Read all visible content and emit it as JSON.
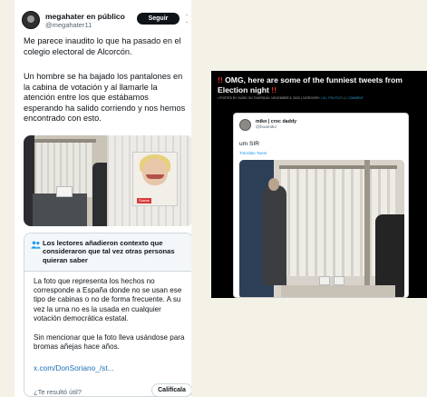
{
  "tweet": {
    "display_name": "megahater en público",
    "handle": "@megahater11",
    "follow_label": "Seguir",
    "more_icon": "more-options-icon",
    "paragraph_1": "Me parece inaudito lo que ha pasado en el colegio electoral de Alcorcón.",
    "paragraph_2": "Un hombre se ha bajado los pantalones en la cabina de votación y al llamarle la atención entre los que estábamos esperando ha salido corriendo y nos hemos encontrado con esto.",
    "media": {
      "left_photo": "voting-booth-photo",
      "right_photo": "campaign-poster-photo",
      "poster_badge": "Sumar"
    },
    "community_note": {
      "icon": "people-icon",
      "title": "Los lectores añadieron contexto que consideraron que tal vez otras personas quieran saber",
      "paragraph_1": "La foto que representa los hechos no corresponde a España donde no se usan ese tipo de cabinas o no de forma frecuente. A su vez la urna no es la usada en cualquier votación democrática estatal.",
      "paragraph_2": "Sin mencionar que la foto lleva usándose para bromas añejas hace años.",
      "link": "x.com/DonSoriano_/st...",
      "useful_question": "¿Te resultó útil?",
      "rate_label": "Califícala"
    }
  },
  "article": {
    "bang_left": "!!",
    "title": " OMG, here are some of the funniest tweets from Election night ",
    "bang_right": "!!",
    "meta_prefix": "• POSTED BY SUSIE ON THURSDAY, NOVEMBER 5, 2020 | CATEGORY: ",
    "meta_category": "LOL, POLITICS",
    "meta_separator": " | ",
    "meta_comment": "1 COMMENT",
    "embed": {
      "name": "miko | croc daddy",
      "handle": "@hoamiko",
      "text": "um SIR",
      "translate": "Translate Tweet",
      "photo": "voting-booth-photo"
    }
  },
  "colors": {
    "accent_blue": "#1d9bf0",
    "alert_red": "#e8342a",
    "link_blue": "#1d6fb5"
  }
}
